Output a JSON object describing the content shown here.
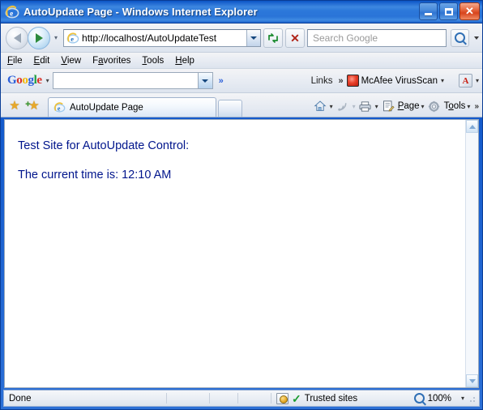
{
  "window": {
    "title": "AutoUpdate Page - Windows Internet Explorer",
    "icon": "internet-explorer-icon",
    "controls": {
      "minimize": "–",
      "maximize": "❐",
      "close": "✕"
    }
  },
  "navigation": {
    "back_label": "Back",
    "forward_label": "Forward",
    "history_caret": "▾",
    "address": {
      "value": "http://localhost/AutoUpdateTest",
      "dropdown_caret": "▾"
    },
    "refresh_label": "↻",
    "stop_label": "✕",
    "search": {
      "placeholder": "Search Google",
      "go_label": "search-icon",
      "caret": "▾"
    }
  },
  "menubar": {
    "items": [
      {
        "pre": "",
        "key": "F",
        "post": "ile"
      },
      {
        "pre": "",
        "key": "E",
        "post": "dit"
      },
      {
        "pre": "",
        "key": "V",
        "post": "iew"
      },
      {
        "pre": "F",
        "key": "a",
        "post": "vorites"
      },
      {
        "pre": "",
        "key": "T",
        "post": "ools"
      },
      {
        "pre": "",
        "key": "H",
        "post": "elp"
      }
    ]
  },
  "google_toolbar": {
    "logo": [
      "G",
      "o",
      "o",
      "g",
      "l",
      "e"
    ],
    "logo_caret": "▾",
    "search_value": "",
    "search_caret": "▾",
    "more_chevron": "»",
    "links_label": "Links",
    "links_chevron": "»",
    "mcafee_label": "McAfee VirusScan",
    "mcafee_caret": "▾",
    "pdf_label": "A",
    "pdf_caret": "▾"
  },
  "tabbar": {
    "favorites_star": "★",
    "add_favorite_star": "★",
    "add_favorite_plus": "+",
    "tabs": [
      {
        "title": "AutoUpdate Page",
        "icon": "internet-explorer-icon",
        "active": true
      }
    ],
    "new_tab_label": "",
    "tools": {
      "home_label": "Home",
      "home_caret": "▾",
      "feeds_label": "Feeds",
      "feeds_caret": "▾",
      "print_label": "Print",
      "print_caret": "▾",
      "page_pre": "",
      "page_key": "P",
      "page_post": "age",
      "page_caret": "▾",
      "tools_pre": "T",
      "tools_key": "o",
      "tools_post": "ols",
      "tools_caret": "▾",
      "overflow_chevron": "»"
    }
  },
  "page": {
    "heading": "Test Site for AutoUpdate Control:",
    "time_line": "The current time is:  12:10 AM",
    "text_color": "#00158c"
  },
  "scrollbar": {
    "up_arrow": "▲",
    "down_arrow": "▼"
  },
  "statusbar": {
    "status": "Done",
    "zone_icon": "security-zone-icon",
    "zone_check": "✓",
    "zone_label": "Trusted sites",
    "zoom_label": "100%",
    "zoom_caret": "▾"
  }
}
